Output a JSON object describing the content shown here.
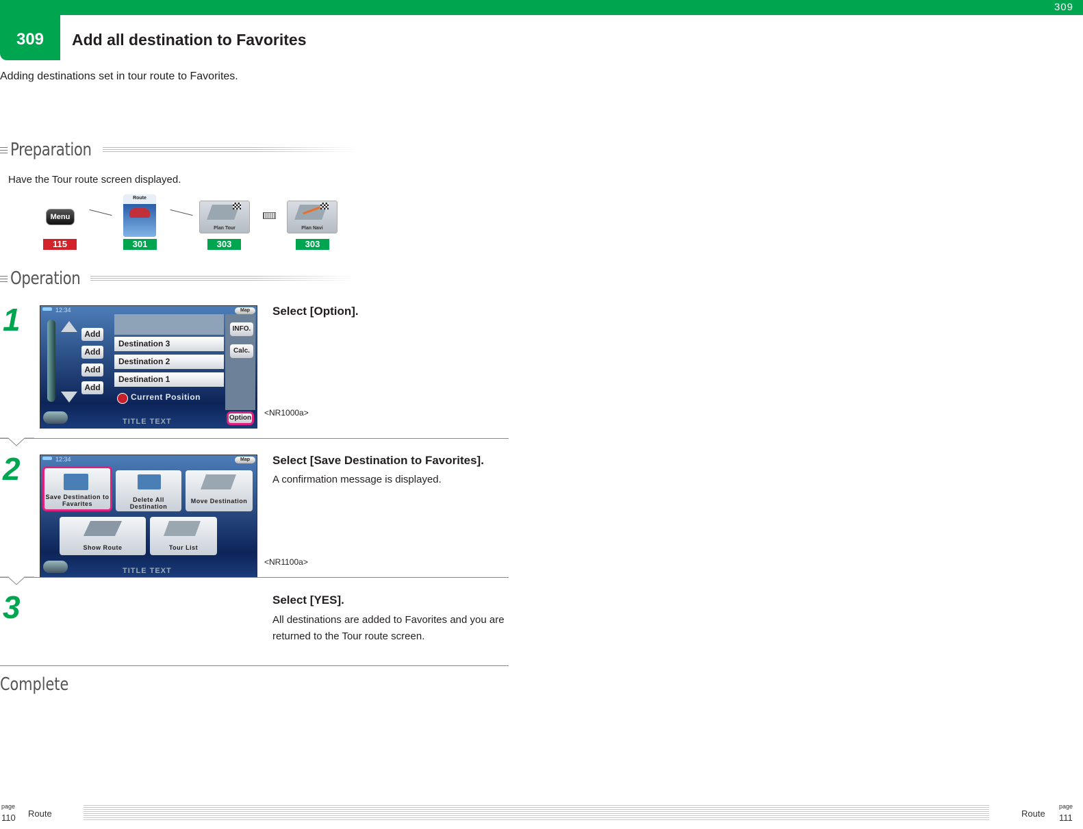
{
  "header": {
    "top_number": "309",
    "tab_number": "309",
    "title": "Add all destination to Favorites",
    "subtitle": "Adding destinations set in tour route to Favorites.",
    "accent_color": "#00a550"
  },
  "preparation": {
    "heading": "Preparation",
    "text": "Have the Tour route screen displayed.",
    "steps": [
      {
        "label": "Menu",
        "badge": "115",
        "badge_color": "#d2232a",
        "icon": "menu-button-icon"
      },
      {
        "label": "Route",
        "badge": "301",
        "badge_color": "#00a550",
        "icon": "route-icon"
      },
      {
        "label": "Plan Tour",
        "badge": "303",
        "badge_color": "#00a550",
        "icon": "plan-tour-icon"
      },
      {
        "label": "Plan Navi",
        "badge": "303",
        "badge_color": "#00a550",
        "icon": "plan-navi-icon"
      }
    ],
    "separator_symbol": "or-symbol"
  },
  "operation": {
    "heading": "Operation",
    "steps": [
      {
        "number": "1",
        "title": "Select [Option].",
        "description": "",
        "caption": "<NR1000a>",
        "screen": {
          "clock": "12:34",
          "map_button": "Map",
          "add_buttons": [
            "Add",
            "Add",
            "Add",
            "Add"
          ],
          "destinations": [
            "Destination 3",
            "Destination 2",
            "Destination 1"
          ],
          "current_position": "Current Position",
          "info_button": "INFO.",
          "calc_button": "Calc.",
          "option_button": "Option",
          "title_text": "TITLE TEXT"
        }
      },
      {
        "number": "2",
        "title": "Select [Save Destination to Favorites].",
        "description": "A confirmation message is displayed.",
        "caption": "<NR1100a>",
        "screen": {
          "clock": "12:34",
          "map_button": "Map",
          "tiles": [
            "Save Destination to Favarites",
            "Delete All Destination",
            "Move Destination",
            "Show Route",
            "Tour List"
          ],
          "title_text": "TITLE TEXT"
        }
      },
      {
        "number": "3",
        "title": "Select [YES].",
        "description": "All destinations are added to Favorites and you are returned to the Tour route screen.",
        "caption": ""
      }
    ]
  },
  "complete": "Complete",
  "footer": {
    "page_label_left": "page",
    "page_left": "110",
    "section_left": "Route",
    "section_right": "Route",
    "page_label_right": "page",
    "page_right": "111"
  }
}
